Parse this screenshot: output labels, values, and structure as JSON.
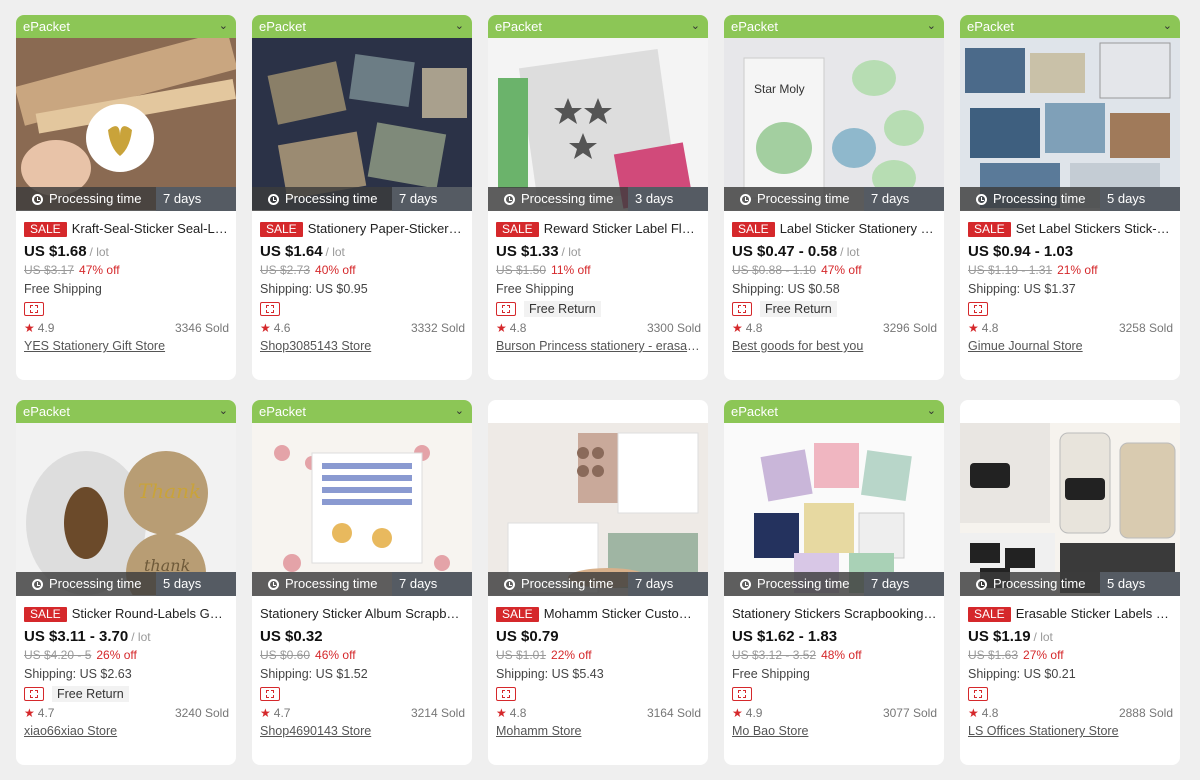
{
  "products": [
    {
      "shipping_tag": "ePacket",
      "image": "gold-heart-seal-sticker-photo",
      "processing_label": "Processing time",
      "processing_days": "7 days",
      "sale": "SALE",
      "title": "Kraft-Seal-Sticker Seal-Label Gold...",
      "price": "US $1.68",
      "unit": "/ lot",
      "original": "US $3.17",
      "discount": "47% off",
      "shipping": "Free Shipping",
      "free_return": "",
      "rating": "4.9",
      "sold": "3346 Sold",
      "store": "YES Stationery Gift Store"
    },
    {
      "shipping_tag": "ePacket",
      "image": "stationery-paper-stickers-photo",
      "processing_label": "Processing time",
      "processing_days": "7 days",
      "sale": "SALE",
      "title": "Stationery Paper-Stickers Scrapbook...",
      "price": "US $1.64",
      "unit": "/ lot",
      "original": "US $2.73",
      "discount": "40% off",
      "shipping": "Shipping: US $0.95",
      "free_return": "",
      "rating": "4.6",
      "sold": "3332 Sold",
      "store": "Shop3085143 Store"
    },
    {
      "shipping_tag": "ePacket",
      "image": "reward-star-heart-stickers-photo",
      "processing_label": "Processing time",
      "processing_days": "3 days",
      "sale": "SALE",
      "title": "Reward Sticker Label Flash Star...",
      "price": "US $1.33",
      "unit": "/ lot",
      "original": "US $1.50",
      "discount": "11% off",
      "shipping": "Free Shipping",
      "free_return": "Free Return",
      "rating": "4.8",
      "sold": "3300 Sold",
      "store": "Burson Princess stationery - erasable..."
    },
    {
      "shipping_tag": "ePacket",
      "image": "star-moly-dinosaur-stickers-photo",
      "processing_label": "Processing time",
      "processing_days": "7 days",
      "sale": "SALE",
      "title": "Label Sticker Stationery Scrapbooking...",
      "price": "US $0.47 - 0.58",
      "unit": "/ lot",
      "original": "US $0.88 - 1.10",
      "discount": "47% off",
      "shipping": "Shipping: US $0.58",
      "free_return": "Free Return",
      "rating": "4.8",
      "sold": "3296 Sold",
      "store": "Best goods for best you"
    },
    {
      "shipping_tag": "ePacket",
      "image": "wave-art-label-stickers-photo",
      "processing_label": "Processing time",
      "processing_days": "5 days",
      "sale": "SALE",
      "title": "Set Label Stickers Stick-Label...",
      "price": "US $0.94 - 1.03",
      "unit": "",
      "original": "US $1.19 - 1.31",
      "discount": "21% off",
      "shipping": "Shipping: US $1.37",
      "free_return": "",
      "rating": "4.8",
      "sold": "3258 Sold",
      "store": "Gimue Journal Store"
    },
    {
      "shipping_tag": "ePacket",
      "image": "thank-you-round-labels-roll-photo",
      "processing_label": "Processing time",
      "processing_days": "5 days",
      "sale": "SALE",
      "title": "Sticker Round-Labels Gold Foil...",
      "price": "US $3.11 - 3.70",
      "unit": "/ lot",
      "original": "US $4.20 - 5",
      "discount": "26% off",
      "shipping": "Shipping: US $2.63",
      "free_return": "Free Return",
      "rating": "4.7",
      "sold": "3240 Sold",
      "store": "xiao66xiao Store"
    },
    {
      "shipping_tag": "ePacket",
      "image": "sticker-album-sheets-photo",
      "processing_label": "Processing time",
      "processing_days": "7 days",
      "sale": "",
      "title": "Stationery Sticker Album Scrapbooking...",
      "price": "US $0.32",
      "unit": "",
      "original": "US $0.60",
      "discount": "46% off",
      "shipping": "Shipping: US $1.52",
      "free_return": "",
      "rating": "4.7",
      "sold": "3214 Sold",
      "store": "Shop4690143 Store"
    },
    {
      "shipping_tag": "",
      "image": "mohamm-journal-stickers-photo",
      "processing_label": "Processing time",
      "processing_days": "7 days",
      "sale": "SALE",
      "title": "Mohamm Sticker Custom Journal...",
      "price": "US $0.79",
      "unit": "",
      "original": "US $1.01",
      "discount": "22% off",
      "shipping": "Shipping: US $5.43",
      "free_return": "",
      "rating": "4.8",
      "sold": "3164 Sold",
      "store": "Mohamm Store"
    },
    {
      "shipping_tag": "ePacket",
      "image": "scrapbooking-sticker-packs-photo",
      "processing_label": "Processing time",
      "processing_days": "7 days",
      "sale": "",
      "title": "Stationery Stickers Scrapbooking Label...",
      "price": "US $1.62 - 1.83",
      "unit": "",
      "original": "US $3.12 - 3.52",
      "discount": "48% off",
      "shipping": "Free Shipping",
      "free_return": "",
      "rating": "4.9",
      "sold": "3077 Sold",
      "store": "Mo Bao Store"
    },
    {
      "shipping_tag": "",
      "image": "erasable-jar-labels-photo",
      "processing_label": "Processing time",
      "processing_days": "5 days",
      "sale": "SALE",
      "title": "Erasable Sticker Labels Chalkboard...",
      "price": "US $1.19",
      "unit": "/ lot",
      "original": "US $1.63",
      "discount": "27% off",
      "shipping": "Shipping: US $0.21",
      "free_return": "",
      "rating": "4.8",
      "sold": "2888 Sold",
      "store": "LS Offices Stationery Store"
    }
  ],
  "colors": {
    "shipping_tag": "#8cc656",
    "sale": "#d5282b",
    "accent": "#d5282b"
  },
  "icons": {
    "chevron": "chevron-down-icon",
    "clock": "clock-icon",
    "truck": "choice-ticket-icon",
    "star": "star-icon"
  }
}
